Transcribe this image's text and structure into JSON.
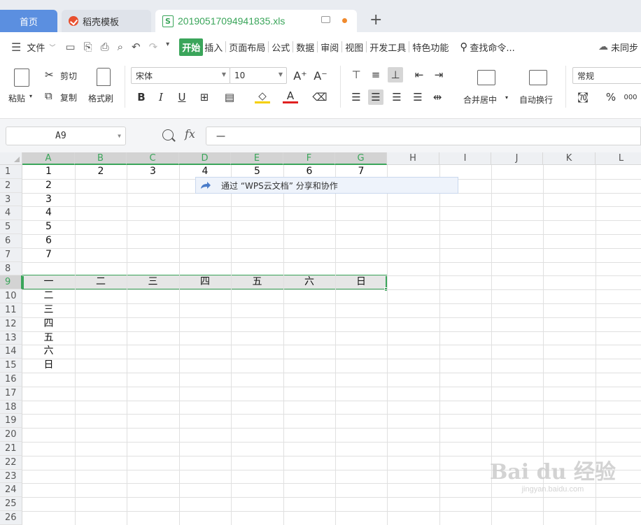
{
  "tabs": {
    "home": "首页",
    "template": "稻壳模板",
    "file": "20190517094941835.xls"
  },
  "menu": {
    "file": "文件",
    "items": [
      "开始",
      "插入",
      "页面布局",
      "公式",
      "数据",
      "审阅",
      "视图",
      "开发工具",
      "特色功能"
    ],
    "search": "查找命令...",
    "cloud": "未同步"
  },
  "ribbon": {
    "paste": "粘贴",
    "cut": "剪切",
    "copy": "复制",
    "format_painter": "格式刷",
    "font_name": "宋体",
    "font_size": "10",
    "merge_center": "合并居中",
    "wrap_text": "自动换行",
    "number_format": "常规",
    "bold": "B",
    "italic": "I",
    "underline": "U",
    "grow_font": "A⁺",
    "shrink_font": "A⁻",
    "font_color": "A"
  },
  "formula_bar": {
    "name_box": "A9",
    "fx": "fx",
    "content": "一"
  },
  "grid": {
    "columns": [
      "A",
      "B",
      "C",
      "D",
      "E",
      "F",
      "G",
      "H",
      "I",
      "J",
      "K",
      "L"
    ],
    "rows": [
      "1",
      "2",
      "3",
      "4",
      "5",
      "6",
      "7",
      "8",
      "9",
      "10",
      "11",
      "12",
      "13",
      "14",
      "15",
      "16",
      "17",
      "18",
      "19",
      "20",
      "21",
      "22",
      "23",
      "24",
      "25",
      "26"
    ],
    "selected_row": "9",
    "row1": [
      "1",
      "2",
      "3",
      "4",
      "5",
      "6",
      "7"
    ],
    "colA": [
      "1",
      "2",
      "3",
      "4",
      "5",
      "6",
      "7",
      "",
      "一",
      "二",
      "三",
      "四",
      "五",
      "六",
      "日"
    ],
    "row9": [
      "一",
      "二",
      "三",
      "四",
      "五",
      "六",
      "日"
    ]
  },
  "share_tip": "通过  “WPS云文档”  分享和协作",
  "watermark": {
    "brand": "Bai du 经验",
    "url": "jingyan.baidu.com"
  },
  "colors": {
    "accent": "#3aa55a",
    "home_tab": "#5b8fe0"
  }
}
